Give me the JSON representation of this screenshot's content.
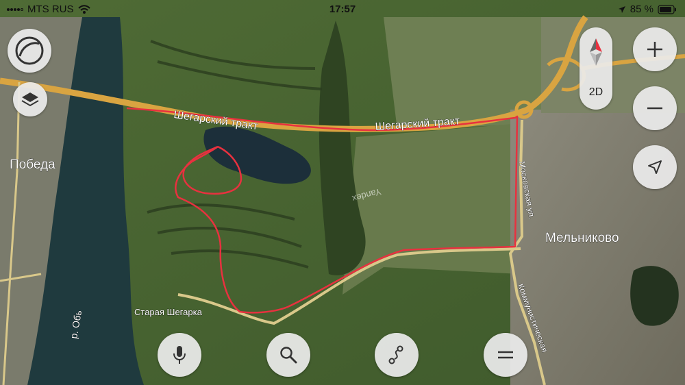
{
  "status_bar": {
    "carrier": "MTS RUS",
    "time": "17:57",
    "battery": "85 %"
  },
  "map": {
    "labels": {
      "road_name_1": "Шегарский тракт",
      "road_name_2": "Шегарский тракт",
      "village_pobeda": "Победа",
      "village_melnikovo": "Мельниково",
      "village_staraya_shegarka": "Старая Шегарка",
      "street_moskovskaya": "Московская ул.",
      "street_kommunisticheskaya": "Коммунистическая",
      "river": "р. Обь",
      "watermark": "Yandex"
    },
    "route_color": "#e8313f",
    "road_color": "#d9a441"
  },
  "controls": {
    "map_mode": "2D",
    "icons": [
      "yandex-logo-icon",
      "layers-icon",
      "compass-icon",
      "zoom-in-icon",
      "zoom-out-icon",
      "location-arrow-icon",
      "microphone-icon",
      "search-icon",
      "route-icon",
      "menu-icon"
    ]
  }
}
